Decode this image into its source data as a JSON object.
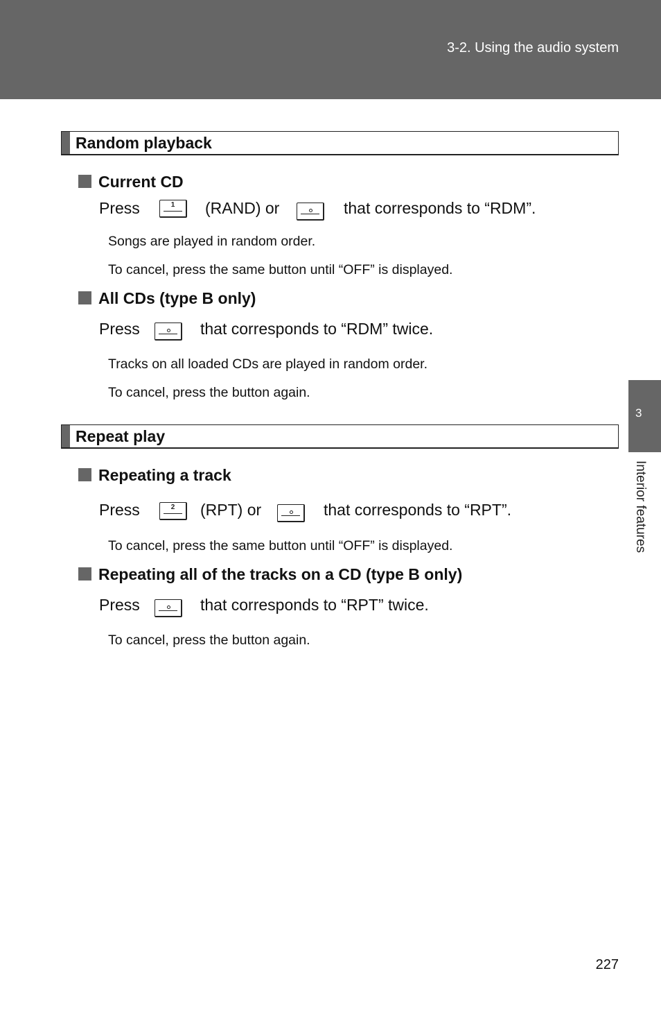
{
  "header": {
    "section": "3-2. Using the audio system"
  },
  "side_tab": {
    "number": "3",
    "label": "Interior features"
  },
  "sections": [
    {
      "title": "Random playback",
      "subsections": [
        {
          "title": "Current CD",
          "press": {
            "prefix": "Press",
            "button1_label": "1",
            "middle": "(RAND) or",
            "suffix": "that corresponds to “RDM”."
          },
          "notes": [
            "Songs are played in random order.",
            "To cancel, press the same button until “OFF” is displayed."
          ]
        },
        {
          "title": "All CDs (type B only)",
          "press": {
            "prefix": "Press",
            "suffix": "that corresponds to “RDM” twice."
          },
          "notes": [
            "Tracks on all loaded CDs are played in random order.",
            "To cancel, press the button again."
          ]
        }
      ]
    },
    {
      "title": "Repeat play",
      "subsections": [
        {
          "title": "Repeating a track",
          "press": {
            "prefix": "Press",
            "button1_label": "2",
            "middle": "(RPT) or",
            "suffix": "that corresponds to “RPT”."
          },
          "notes": [
            "To cancel, press the same button until “OFF” is displayed."
          ]
        },
        {
          "title": "Repeating all of the tracks on a CD (type B only)",
          "press": {
            "prefix": "Press",
            "suffix": "that corresponds to “RPT” twice."
          },
          "notes": [
            "To cancel, press the button again."
          ]
        }
      ]
    }
  ],
  "page_number": "227"
}
